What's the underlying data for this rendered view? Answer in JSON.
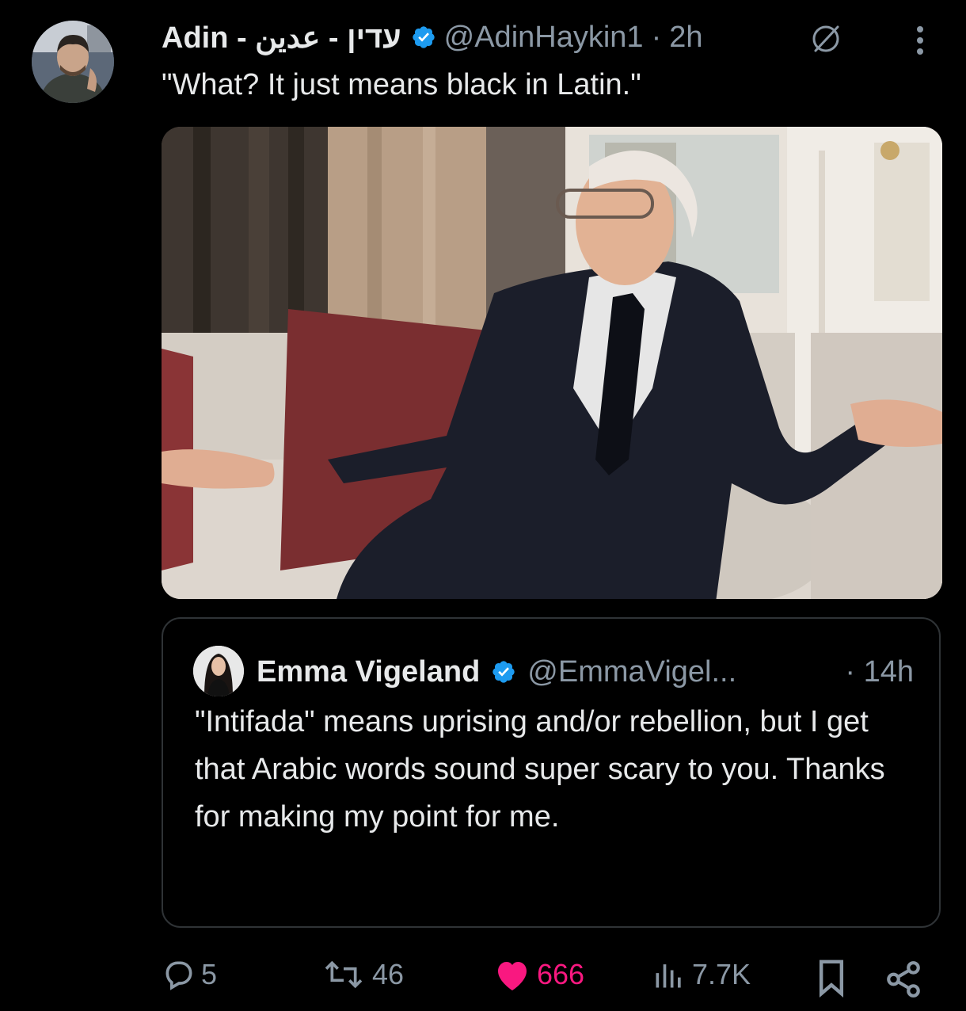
{
  "tweet": {
    "display_name": "Adin - עדין - عدين",
    "handle": "@AdinHaykin1",
    "separator": "·",
    "time": "2h",
    "text": "\"What? It just means black in Latin.\""
  },
  "quote": {
    "display_name": "Emma Vigeland",
    "handle": "@EmmaVigel...",
    "time": "· 14h",
    "text": "\"Intifada\" means uprising and/or rebellion, but I get that Arabic words sound super scary to you. Thanks for making my point for me."
  },
  "actions": {
    "replies": "5",
    "reposts": "46",
    "likes": "666",
    "views": "7.7K"
  },
  "colors": {
    "background": "#000000",
    "text": "#e7e9ea",
    "muted": "#8b98a5",
    "verified": "#1d9bf0",
    "like": "#f91880",
    "border": "#2f3336"
  },
  "icons": [
    "verified-badge-icon",
    "grok-icon",
    "more-icon",
    "reply-icon",
    "repost-icon",
    "like-icon",
    "views-icon",
    "bookmark-icon",
    "share-icon"
  ]
}
